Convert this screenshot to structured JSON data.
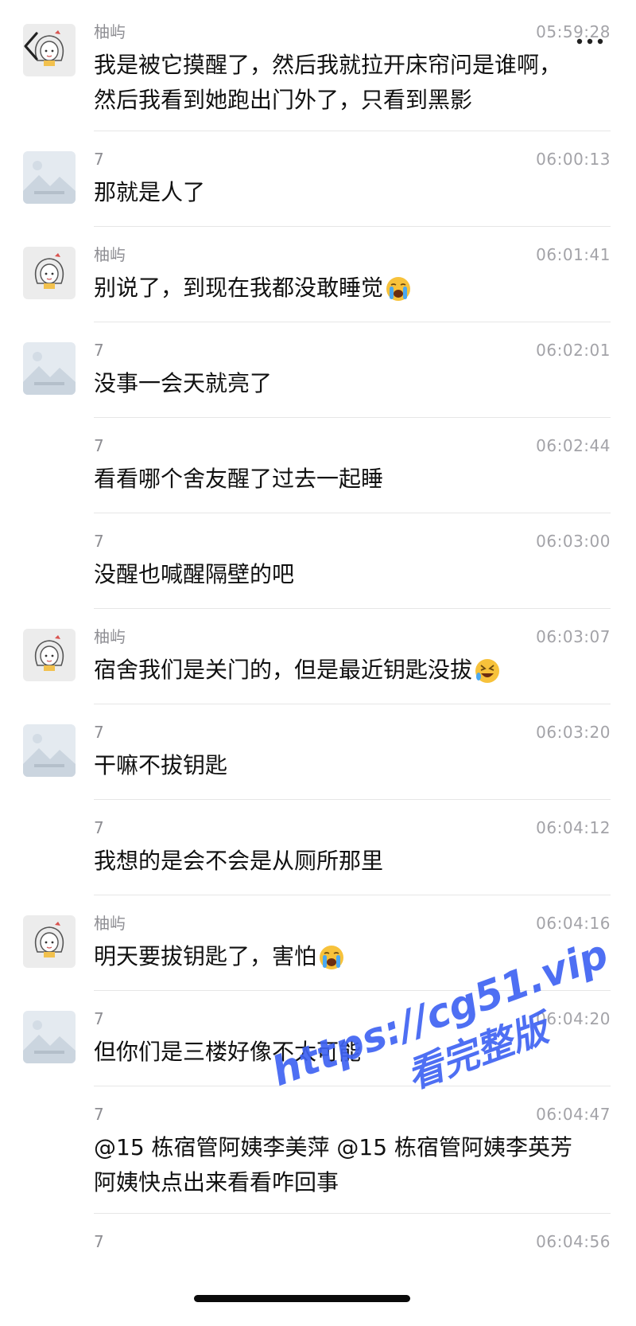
{
  "header": {
    "back_icon": "chevron-left-icon",
    "more_icon": "more-dots-icon"
  },
  "messages": [
    {
      "sender": "柚屿",
      "time": "05:59:28",
      "avatar": "girl-avatar",
      "text": "我是被它摸醒了，然后我就拉开床帘问是谁啊，\n然后我看到她跑出门外了，只看到黑影"
    },
    {
      "sender": "7",
      "time": "06:00:13",
      "avatar": "landscape-avatar",
      "text": "那就是人了"
    },
    {
      "sender": "柚屿",
      "time": "06:01:41",
      "avatar": "girl-avatar",
      "text": "别说了，到现在我都没敢睡觉",
      "emoji": "crying-face-emoji"
    },
    {
      "sender": "7",
      "time": "06:02:01",
      "avatar": "landscape-avatar",
      "text": "没事一会天就亮了"
    },
    {
      "sender": "7",
      "time": "06:02:44",
      "avatar": "",
      "text": "看看哪个舍友醒了过去一起睡"
    },
    {
      "sender": "7",
      "time": "06:03:00",
      "avatar": "",
      "text": "没醒也喊醒隔壁的吧"
    },
    {
      "sender": "柚屿",
      "time": "06:03:07",
      "avatar": "girl-avatar",
      "text": "宿舍我们是关门的，但是最近钥匙没拔",
      "emoji": "rolling-laughing-emoji"
    },
    {
      "sender": "7",
      "time": "06:03:20",
      "avatar": "landscape-avatar",
      "text": "干嘛不拔钥匙"
    },
    {
      "sender": "7",
      "time": "06:04:12",
      "avatar": "",
      "text": "我想的是会不会是从厕所那里"
    },
    {
      "sender": "柚屿",
      "time": "06:04:16",
      "avatar": "girl-avatar",
      "text": "明天要拔钥匙了，害怕",
      "emoji": "crying-face-emoji"
    },
    {
      "sender": "7",
      "time": "06:04:20",
      "avatar": "landscape-avatar",
      "text": "但你们是三楼好像不太可能"
    },
    {
      "sender": "7",
      "time": "06:04:47",
      "avatar": "",
      "text": "@15 栋宿管阿姨李美萍 @15 栋宿管阿姨李英芳\n阿姨快点出来看看咋回事"
    },
    {
      "sender": "7",
      "time": "06:04:56",
      "avatar": "",
      "text": ""
    }
  ],
  "watermark": {
    "url": "https://cg51.vip",
    "subtitle": "看完整版"
  },
  "colors": {
    "watermark": "#3f63f2",
    "divider": "#e6e6e6",
    "meta_text": "#8e8e93"
  }
}
